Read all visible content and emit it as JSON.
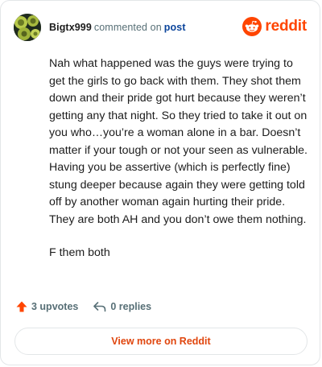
{
  "comment": {
    "username": "Bigtx999",
    "action_text": "commented on",
    "post_link": "post",
    "paragraphs": [
      "Nah what happened was the guys were trying to get the girls to go back with them. They shot them down and their pride got hurt because they weren’t getting any that night. So they tried to take it out on you who…you’re a woman alone in a bar. Doesn’t matter if your tough or not your seen as vulnerable. Having you be assertive (which is perfectly fine) stung deeper because again they were getting told off by another woman again hurting their pride. They are both AH and you don’t owe them nothing.",
      "F them both"
    ]
  },
  "brand": {
    "name": "reddit",
    "icon": "reddit-snoo-icon",
    "color": "#ff4500"
  },
  "footer": {
    "upvotes": "3 upvotes",
    "upvote_icon": "upvote-arrow-icon",
    "upvote_color": "#ff4500",
    "replies": "0 replies",
    "reply_icon": "reply-arrow-icon"
  },
  "view_more_label": "View more on Reddit",
  "accent_color": "#e0460e",
  "link_color": "#0a449b"
}
